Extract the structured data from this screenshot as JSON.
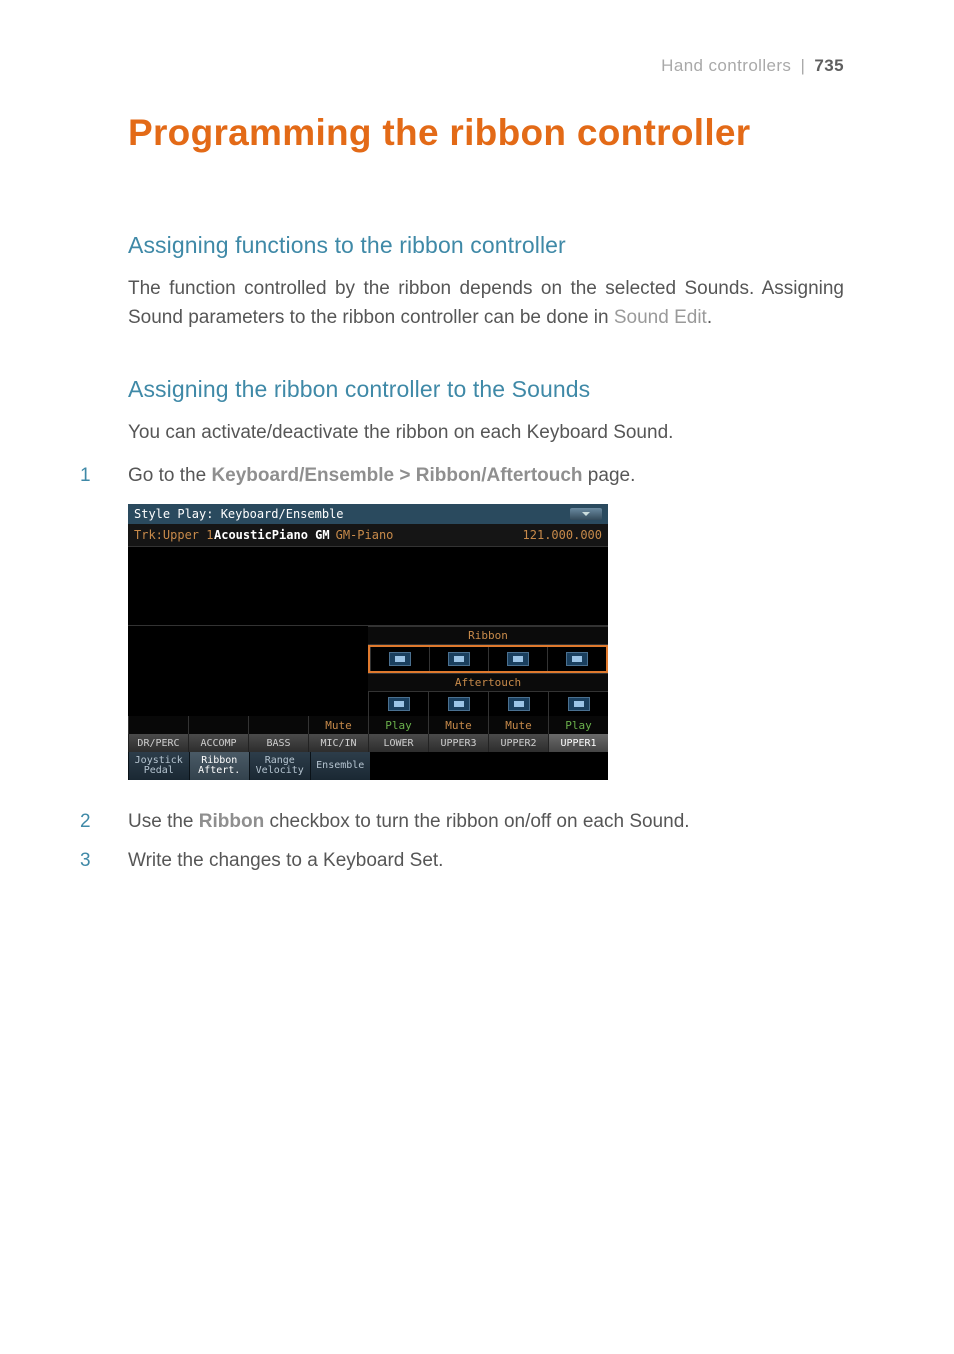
{
  "header": {
    "section": "Hand controllers",
    "divider": "|",
    "page": "735"
  },
  "title": "Programming the ribbon controller",
  "s1": {
    "heading": "Assigning functions to the ribbon controller",
    "para_a": "The function controlled by the ribbon depends on the selected Sounds. Assigning Sound parameters to the ribbon controller can be done in ",
    "para_b": "Sound Edit",
    "para_c": "."
  },
  "s2": {
    "heading": "Assigning the ribbon controller to the Sounds",
    "intro": "You can activate/deactivate the ribbon on each Keyboard Sound."
  },
  "steps": {
    "n1": "1",
    "n2": "2",
    "n3": "3",
    "s1a": "Go to the ",
    "s1b": "Keyboard/Ensemble > Ribbon/Aftertouch",
    "s1c": " page.",
    "s2a": "Use the ",
    "s2b": "Ribbon",
    "s2c": " checkbox to turn the ribbon on/off on each Sound.",
    "s3": "Write the changes to a Keyboard Set."
  },
  "shot": {
    "title": "Style Play: Keyboard/Ensemble",
    "trk": "Trk:Upper 1",
    "sound_name": "AcousticPiano GM",
    "sound_family": "GM-Piano",
    "sound_number": "121.000.000",
    "ribbon_label": "Ribbon",
    "after_label": "Aftertouch",
    "status": {
      "mute": "Mute",
      "play": "Play"
    },
    "tracks": [
      "DR/PERC",
      "ACCOMP",
      "BASS",
      "MIC/IN",
      "LOWER",
      "UPPER3",
      "UPPER2",
      "UPPER1"
    ],
    "tabs": [
      "Joystick Pedal",
      "Ribbon Aftert.",
      "Range Velocity",
      "Ensemble"
    ]
  }
}
